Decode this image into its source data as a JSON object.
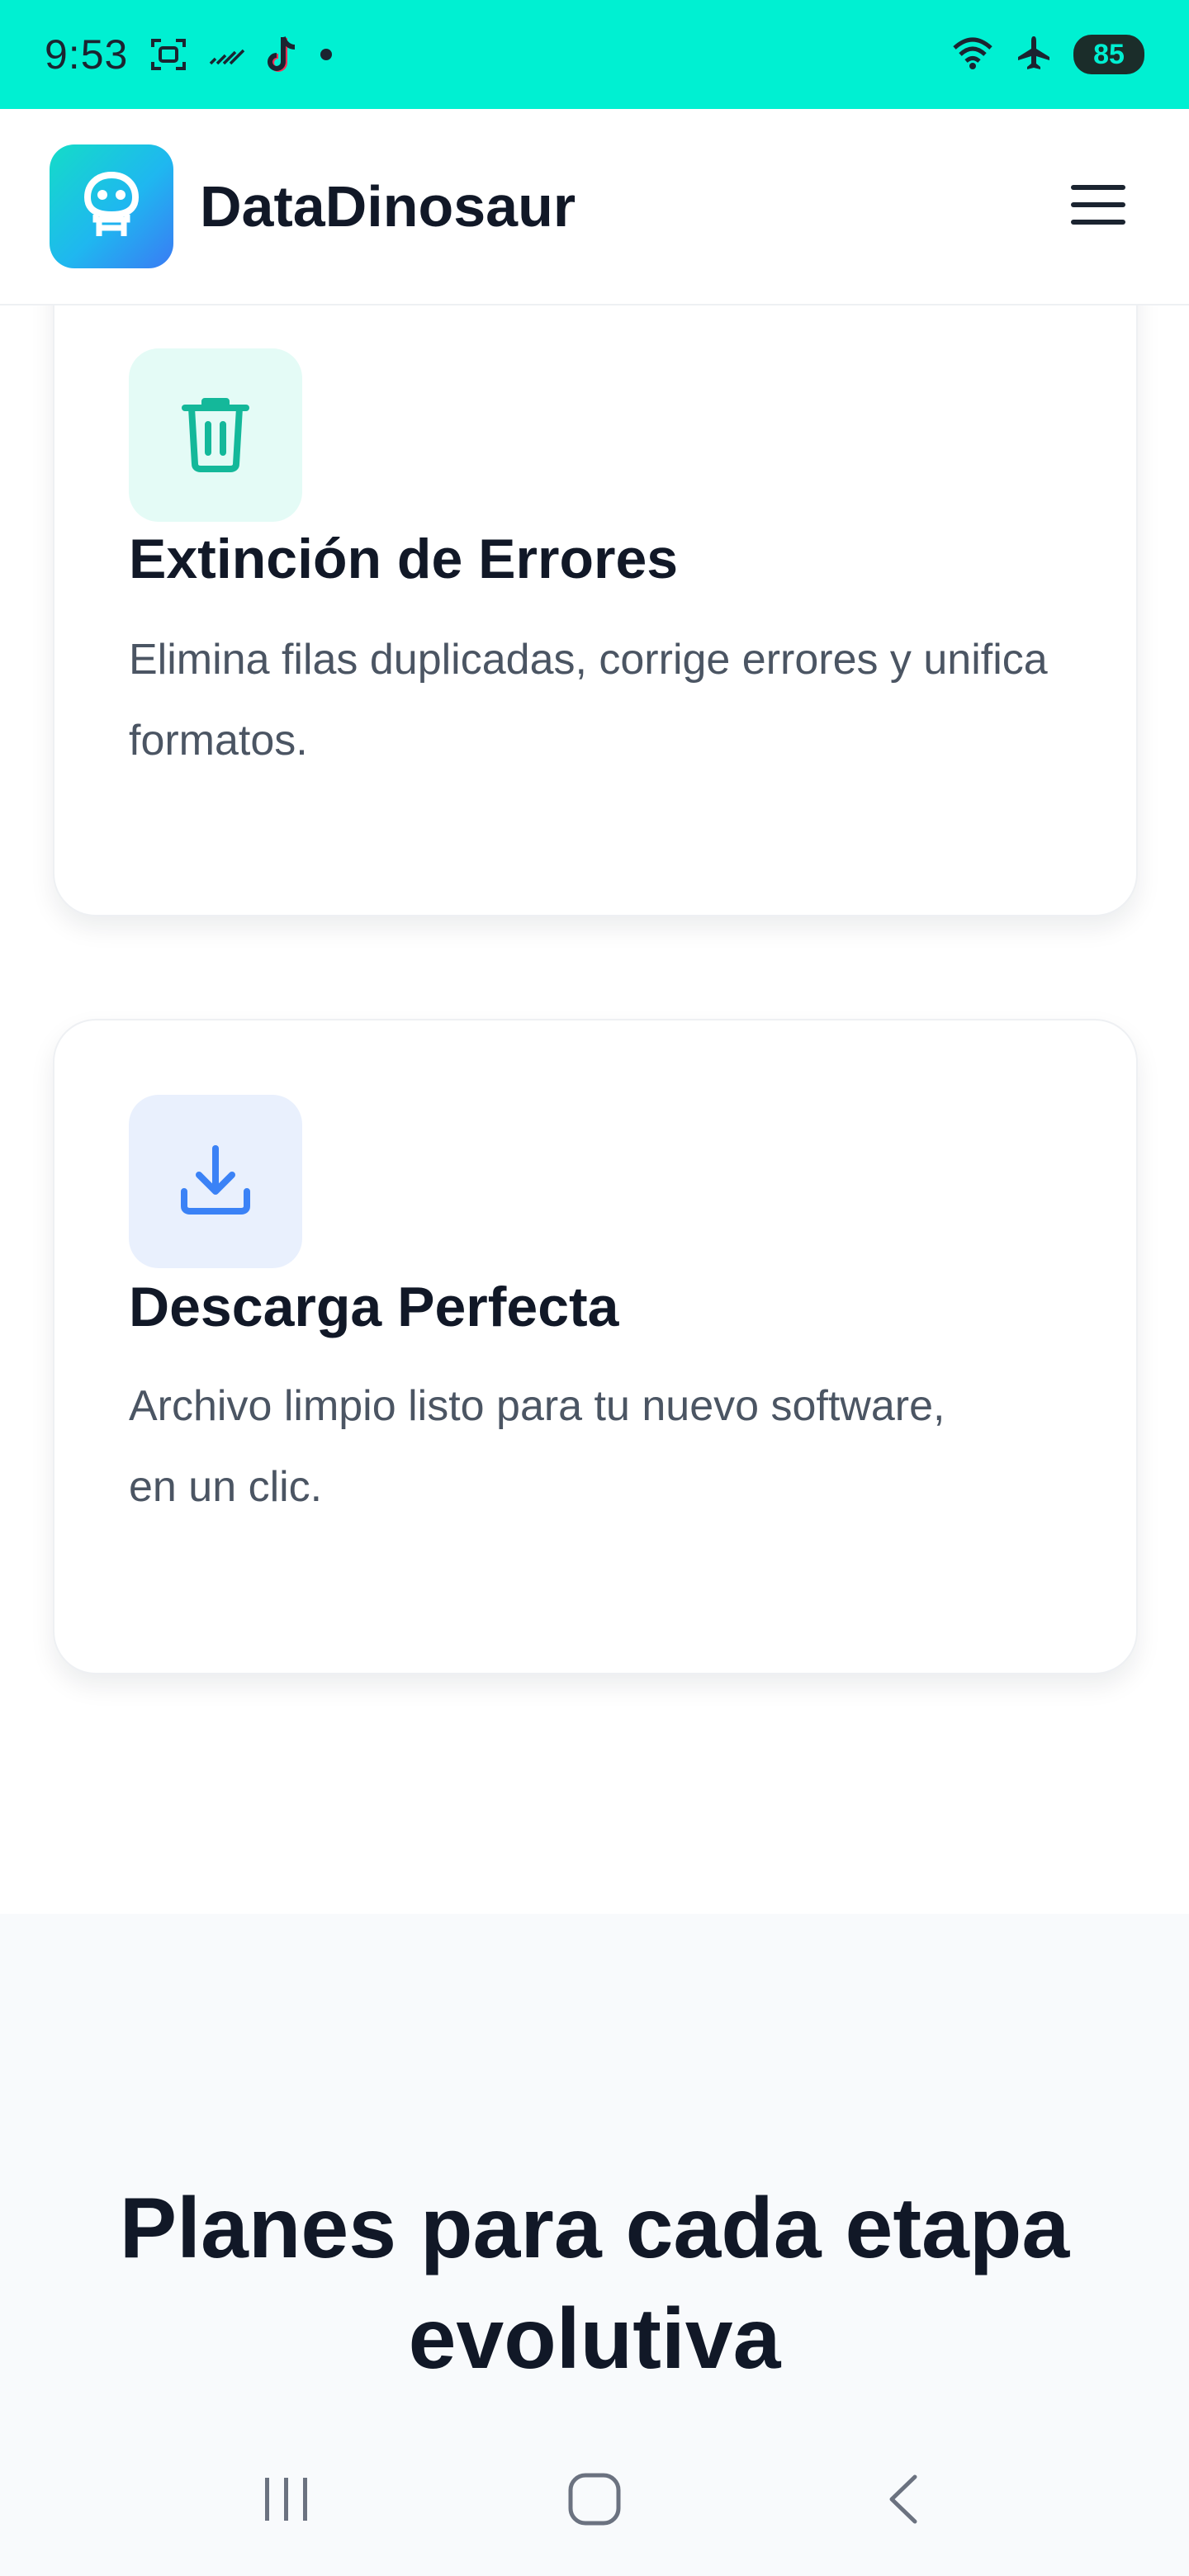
{
  "status_bar": {
    "time": "9:53",
    "battery": "85",
    "icons": [
      "screenshot-icon",
      "no-signal-icon",
      "tiktok-icon",
      "dot-icon",
      "wifi-icon",
      "airplane-icon",
      "battery-icon"
    ]
  },
  "header": {
    "brand": "DataDinosaur",
    "logo_icon": "robot-face-icon",
    "menu_icon": "hamburger-menu-icon"
  },
  "features": [
    {
      "icon": "trash-icon",
      "title": "Extinción de Errores",
      "description": "Elimina filas duplicadas, corrige errores y unifica formatos."
    },
    {
      "icon": "download-icon",
      "title": "Descarga Perfecta",
      "description": "Archivo limpio listo para tu nuevo software, en un clic."
    }
  ],
  "plans": {
    "heading": "Planes para cada etapa evolutiva"
  },
  "nav_bar": {
    "buttons": [
      "recent-apps-icon",
      "home-icon",
      "back-icon"
    ]
  },
  "colors": {
    "status_bar": "#00f0d2",
    "brand_gradient_start": "#14dcc8",
    "brand_gradient_end": "#3a7bf4",
    "trash_icon": "#14b89a",
    "download_icon": "#3b82f6",
    "heading_text": "#111827",
    "body_text": "#4b5563"
  }
}
